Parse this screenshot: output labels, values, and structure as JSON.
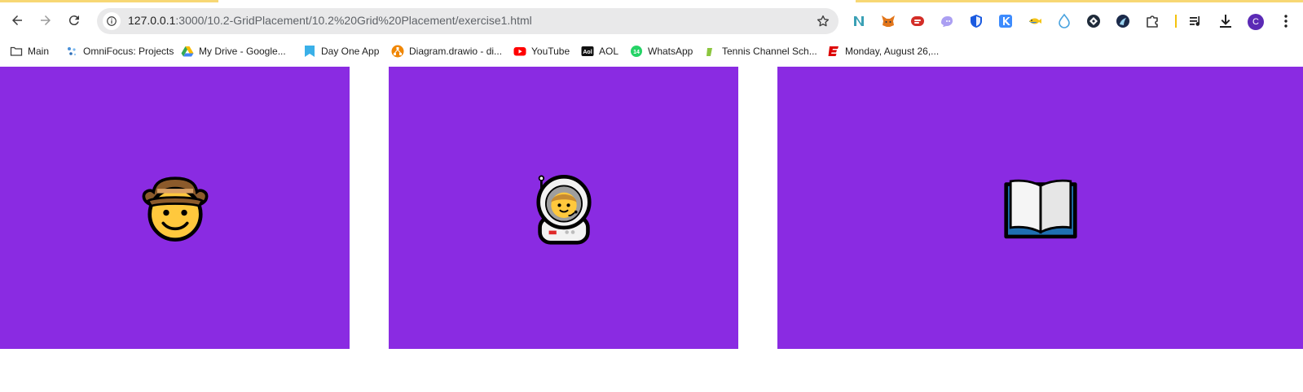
{
  "browser": {
    "url_host": "127.0.0.1",
    "url_path": ":3000/10.2-GridPlacement/10.2%20Grid%20Placement/exercise1.html",
    "profile_initial": "C",
    "extensions": [
      "notion-calendar-icon",
      "metamask-fox-icon",
      "lastpass-icon",
      "ghost-icon",
      "shield-icon",
      "kanban-k-icon",
      "fish-icon",
      "water-drop-icon",
      "diamond-icon",
      "hex-icon",
      "puzzle-icon"
    ]
  },
  "bookmarks": [
    {
      "label": "Main",
      "icon": "folder-icon"
    },
    {
      "label": "OmniFocus: Projects",
      "icon": "omnifocus-icon"
    },
    {
      "label": "My Drive - Google...",
      "icon": "google-drive-icon"
    },
    {
      "label": "Day One App",
      "icon": "day-one-icon"
    },
    {
      "label": "Diagram.drawio - di...",
      "icon": "drawio-icon"
    },
    {
      "label": "YouTube",
      "icon": "youtube-icon"
    },
    {
      "label": "AOL",
      "icon": "aol-icon"
    },
    {
      "label": "WhatsApp",
      "icon": "whatsapp-icon"
    },
    {
      "label": "Tennis Channel Sch...",
      "icon": "tennis-channel-icon"
    },
    {
      "label": "Monday, August 26,...",
      "icon": "espn-icon"
    }
  ],
  "grid": {
    "background_color": "#8a2be2",
    "items": [
      {
        "emoji": "cowboy-hat-face-icon"
      },
      {
        "emoji": "astronaut-icon"
      },
      {
        "emoji": "open-book-icon"
      }
    ]
  }
}
